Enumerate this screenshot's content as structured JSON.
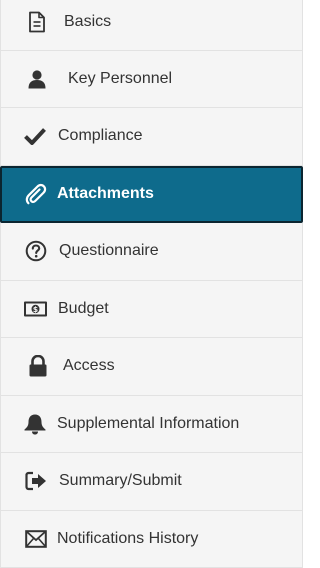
{
  "nav": {
    "items": [
      {
        "label": "Basics",
        "icon": "document-icon",
        "active": false
      },
      {
        "label": "Key Personnel",
        "icon": "user-icon",
        "active": false
      },
      {
        "label": "Compliance",
        "icon": "checkmark-icon",
        "active": false
      },
      {
        "label": "Attachments",
        "icon": "paperclip-icon",
        "active": true
      },
      {
        "label": "Questionnaire",
        "icon": "question-circle-icon",
        "active": false
      },
      {
        "label": "Budget",
        "icon": "money-icon",
        "active": false
      },
      {
        "label": "Access",
        "icon": "lock-icon",
        "active": false
      },
      {
        "label": "Supplemental Information",
        "icon": "bell-icon",
        "active": false
      },
      {
        "label": "Summary/Submit",
        "icon": "sign-out-icon",
        "active": false
      },
      {
        "label": "Notifications History",
        "icon": "envelope-icon",
        "active": false
      }
    ]
  },
  "colors": {
    "active_background": "#0e6b8c",
    "active_border": "#0b2530",
    "item_background": "#f5f5f5",
    "text": "#333333"
  }
}
